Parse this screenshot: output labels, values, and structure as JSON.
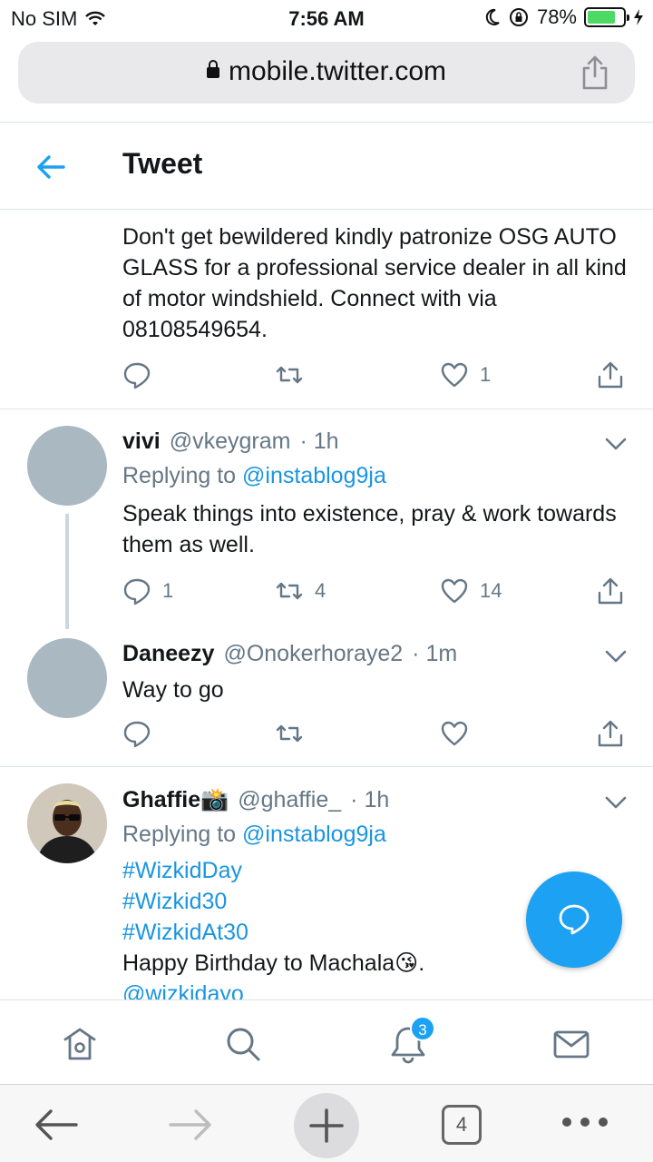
{
  "status_bar": {
    "carrier": "No SIM",
    "time": "7:56 AM",
    "battery": "78%",
    "battery_level": 0.78
  },
  "browser": {
    "url": "mobile.twitter.com",
    "tabs_count": "4"
  },
  "header": {
    "title": "Tweet"
  },
  "main_tweet": {
    "text": "Don't get bewildered kindly patronize OSG AUTO GLASS for a professional service dealer in all kind of motor windshield. Connect with via 08108549654.",
    "likes": "1"
  },
  "replies": [
    {
      "name": "vivi",
      "handle": "@vkeygram",
      "time": "· 1h",
      "replying_prefix": "Replying to",
      "replying_to": "@instablog9ja",
      "text": "Speak things into existence, pray & work towards them as well.",
      "replies": "1",
      "retweets": "4",
      "likes": "14"
    },
    {
      "name": "Daneezy",
      "handle": "@Onokerhoraye2",
      "time": "· 1m",
      "text": "Way to go"
    },
    {
      "name": "Ghaffie",
      "name_emoji": "📸",
      "handle": "@ghaffie_",
      "time": "· 1h",
      "replying_prefix": "Replying to",
      "replying_to": "@instablog9ja",
      "hashtags": [
        "#WizkidDay",
        "#Wizkid30",
        "#WizkidAt30"
      ],
      "text": "Happy Birthday to Machala",
      "text_emoji": "😘",
      "text_end": ".",
      "mention": "@wizkidayo"
    }
  ],
  "tab_bar": {
    "notifications_badge": "3"
  },
  "colors": {
    "accent": "#1da1f2",
    "link": "#1b95e0",
    "secondary_text": "#657786"
  }
}
